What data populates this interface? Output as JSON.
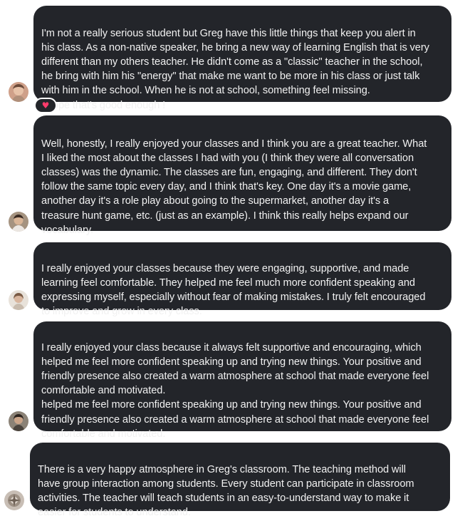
{
  "messages": [
    {
      "text": "I'm not a really serious student but Greg have this little things that keep you alert in\nhis class. As a non-native speaker, he bring a new way of learning English that is very\ndifferent than my others teacher. He didn't come as a \"classic\" teacher in the school,\nhe bring with him his \"energy\" that make me want to be more in his class or just talk\nwith him in the school. When he is not at school, something feel missing.\nI hope that's good enough !",
      "reaction": "♥"
    },
    {
      "text": "Well, honestly, I really enjoyed your classes and I think you are a great teacher. What\nI liked the most about the classes I had with you (I think they were all conversation\nclasses) was the dynamic. The classes are fun, engaging, and different. They don't\nfollow the same topic every day, and I think that's key. One day it's a movie game,\nanother day it's a role play about going to the supermarket, another day it's a\ntreasure hunt game, etc. (just as an example). I think this really helps expand our\nvocabulary."
    },
    {
      "text": "I really enjoyed your classes because they were engaging, supportive, and made\nlearning feel comfortable. They helped me feel much more confident speaking and\nexpressing myself, especially without fear of making mistakes. I truly felt encouraged\nto improve and grow in every class."
    },
    {
      "text": "I really enjoyed your class because it always felt supportive and encouraging, which\nhelped me feel more confident speaking up and trying new things. Your positive and\nfriendly presence also created a warm atmosphere at school that made everyone feel\ncomfortable and motivated.\nhelped me feel more confident speaking up and trying new things. Your positive and\nfriendly presence also created a warm atmosphere at school that made everyone feel\ncomfortable and motivated."
    },
    {
      "text": "There is a very happy atmosphere in Greg's classroom. The teaching method will\nhave group interaction among students. Every student can participate in classroom\nactivities. The teacher will teach students in an easy-to-understand way to make it\neasier for students to understand."
    }
  ],
  "colors": {
    "bubble": "#23252a",
    "text": "#f1f1f1",
    "reaction_heart": "#ff3b6b"
  },
  "icons": {
    "avatar": "user-avatar-icon",
    "reaction": "heart-icon"
  }
}
